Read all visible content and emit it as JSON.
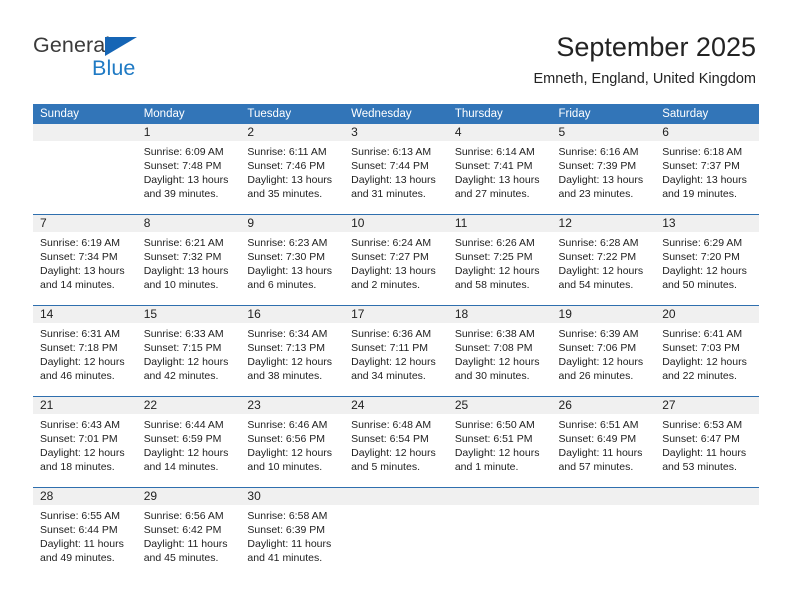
{
  "brand": {
    "name_top": "General",
    "name_bottom": "Blue",
    "triangle_color": "#1565b5",
    "blue_color": "#1f7ac4"
  },
  "header": {
    "title": "September 2025",
    "location": "Emneth, England, United Kingdom"
  },
  "theme": {
    "header_bar": "#3275b8",
    "row_divider": "#2f6fae",
    "daynum_band": "#f0f0f0"
  },
  "calendar": {
    "weekday_headers": [
      "Sunday",
      "Monday",
      "Tuesday",
      "Wednesday",
      "Thursday",
      "Friday",
      "Saturday"
    ],
    "weeks": [
      [
        {
          "day": "",
          "lines": []
        },
        {
          "day": "1",
          "lines": [
            "Sunrise: 6:09 AM",
            "Sunset: 7:48 PM",
            "Daylight: 13 hours",
            "and 39 minutes."
          ]
        },
        {
          "day": "2",
          "lines": [
            "Sunrise: 6:11 AM",
            "Sunset: 7:46 PM",
            "Daylight: 13 hours",
            "and 35 minutes."
          ]
        },
        {
          "day": "3",
          "lines": [
            "Sunrise: 6:13 AM",
            "Sunset: 7:44 PM",
            "Daylight: 13 hours",
            "and 31 minutes."
          ]
        },
        {
          "day": "4",
          "lines": [
            "Sunrise: 6:14 AM",
            "Sunset: 7:41 PM",
            "Daylight: 13 hours",
            "and 27 minutes."
          ]
        },
        {
          "day": "5",
          "lines": [
            "Sunrise: 6:16 AM",
            "Sunset: 7:39 PM",
            "Daylight: 13 hours",
            "and 23 minutes."
          ]
        },
        {
          "day": "6",
          "lines": [
            "Sunrise: 6:18 AM",
            "Sunset: 7:37 PM",
            "Daylight: 13 hours",
            "and 19 minutes."
          ]
        }
      ],
      [
        {
          "day": "7",
          "lines": [
            "Sunrise: 6:19 AM",
            "Sunset: 7:34 PM",
            "Daylight: 13 hours",
            "and 14 minutes."
          ]
        },
        {
          "day": "8",
          "lines": [
            "Sunrise: 6:21 AM",
            "Sunset: 7:32 PM",
            "Daylight: 13 hours",
            "and 10 minutes."
          ]
        },
        {
          "day": "9",
          "lines": [
            "Sunrise: 6:23 AM",
            "Sunset: 7:30 PM",
            "Daylight: 13 hours",
            "and 6 minutes."
          ]
        },
        {
          "day": "10",
          "lines": [
            "Sunrise: 6:24 AM",
            "Sunset: 7:27 PM",
            "Daylight: 13 hours",
            "and 2 minutes."
          ]
        },
        {
          "day": "11",
          "lines": [
            "Sunrise: 6:26 AM",
            "Sunset: 7:25 PM",
            "Daylight: 12 hours",
            "and 58 minutes."
          ]
        },
        {
          "day": "12",
          "lines": [
            "Sunrise: 6:28 AM",
            "Sunset: 7:22 PM",
            "Daylight: 12 hours",
            "and 54 minutes."
          ]
        },
        {
          "day": "13",
          "lines": [
            "Sunrise: 6:29 AM",
            "Sunset: 7:20 PM",
            "Daylight: 12 hours",
            "and 50 minutes."
          ]
        }
      ],
      [
        {
          "day": "14",
          "lines": [
            "Sunrise: 6:31 AM",
            "Sunset: 7:18 PM",
            "Daylight: 12 hours",
            "and 46 minutes."
          ]
        },
        {
          "day": "15",
          "lines": [
            "Sunrise: 6:33 AM",
            "Sunset: 7:15 PM",
            "Daylight: 12 hours",
            "and 42 minutes."
          ]
        },
        {
          "day": "16",
          "lines": [
            "Sunrise: 6:34 AM",
            "Sunset: 7:13 PM",
            "Daylight: 12 hours",
            "and 38 minutes."
          ]
        },
        {
          "day": "17",
          "lines": [
            "Sunrise: 6:36 AM",
            "Sunset: 7:11 PM",
            "Daylight: 12 hours",
            "and 34 minutes."
          ]
        },
        {
          "day": "18",
          "lines": [
            "Sunrise: 6:38 AM",
            "Sunset: 7:08 PM",
            "Daylight: 12 hours",
            "and 30 minutes."
          ]
        },
        {
          "day": "19",
          "lines": [
            "Sunrise: 6:39 AM",
            "Sunset: 7:06 PM",
            "Daylight: 12 hours",
            "and 26 minutes."
          ]
        },
        {
          "day": "20",
          "lines": [
            "Sunrise: 6:41 AM",
            "Sunset: 7:03 PM",
            "Daylight: 12 hours",
            "and 22 minutes."
          ]
        }
      ],
      [
        {
          "day": "21",
          "lines": [
            "Sunrise: 6:43 AM",
            "Sunset: 7:01 PM",
            "Daylight: 12 hours",
            "and 18 minutes."
          ]
        },
        {
          "day": "22",
          "lines": [
            "Sunrise: 6:44 AM",
            "Sunset: 6:59 PM",
            "Daylight: 12 hours",
            "and 14 minutes."
          ]
        },
        {
          "day": "23",
          "lines": [
            "Sunrise: 6:46 AM",
            "Sunset: 6:56 PM",
            "Daylight: 12 hours",
            "and 10 minutes."
          ]
        },
        {
          "day": "24",
          "lines": [
            "Sunrise: 6:48 AM",
            "Sunset: 6:54 PM",
            "Daylight: 12 hours",
            "and 5 minutes."
          ]
        },
        {
          "day": "25",
          "lines": [
            "Sunrise: 6:50 AM",
            "Sunset: 6:51 PM",
            "Daylight: 12 hours",
            "and 1 minute."
          ]
        },
        {
          "day": "26",
          "lines": [
            "Sunrise: 6:51 AM",
            "Sunset: 6:49 PM",
            "Daylight: 11 hours",
            "and 57 minutes."
          ]
        },
        {
          "day": "27",
          "lines": [
            "Sunrise: 6:53 AM",
            "Sunset: 6:47 PM",
            "Daylight: 11 hours",
            "and 53 minutes."
          ]
        }
      ],
      [
        {
          "day": "28",
          "lines": [
            "Sunrise: 6:55 AM",
            "Sunset: 6:44 PM",
            "Daylight: 11 hours",
            "and 49 minutes."
          ]
        },
        {
          "day": "29",
          "lines": [
            "Sunrise: 6:56 AM",
            "Sunset: 6:42 PM",
            "Daylight: 11 hours",
            "and 45 minutes."
          ]
        },
        {
          "day": "30",
          "lines": [
            "Sunrise: 6:58 AM",
            "Sunset: 6:39 PM",
            "Daylight: 11 hours",
            "and 41 minutes."
          ]
        },
        {
          "day": "",
          "lines": []
        },
        {
          "day": "",
          "lines": []
        },
        {
          "day": "",
          "lines": []
        },
        {
          "day": "",
          "lines": []
        }
      ]
    ]
  }
}
